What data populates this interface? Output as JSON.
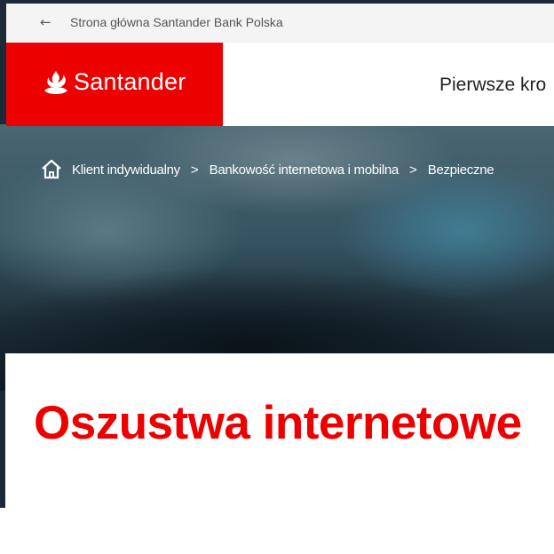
{
  "topbar": {
    "back_icon": "arrow-left-icon",
    "link_text": "Strona główna Santander Bank Polska"
  },
  "header": {
    "logo_text": "Santander",
    "logo_icon": "flame-icon",
    "nav_item": "Pierwsze kro"
  },
  "breadcrumb": {
    "home_icon": "home-icon",
    "items": [
      {
        "label": "Klient indywidualny"
      },
      {
        "label": "Bankowość internetowa i mobilna"
      },
      {
        "label": "Bezpieczne"
      }
    ],
    "separator": ">"
  },
  "main": {
    "title": "Oszustwa internetowe"
  },
  "colors": {
    "brand_red": "#ec0000",
    "topbar_bg": "#f4f4f4"
  }
}
